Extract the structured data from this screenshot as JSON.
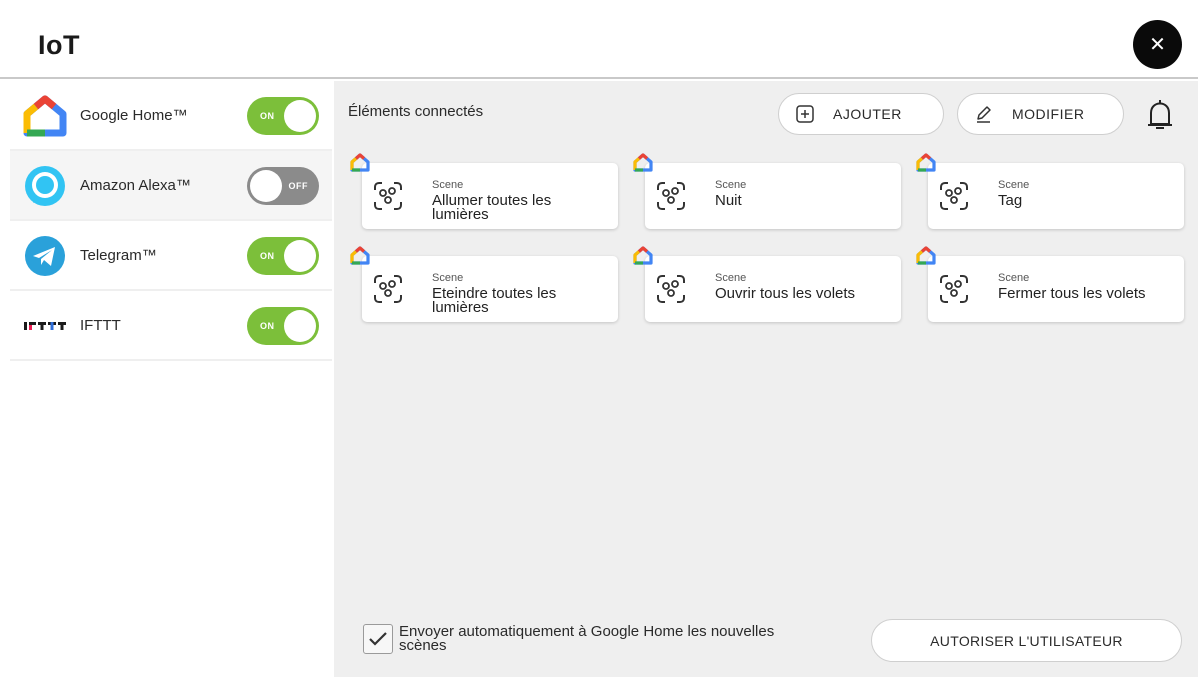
{
  "app": {
    "title": "IoT",
    "close_icon": "close-icon"
  },
  "sidebar": {
    "items": [
      {
        "label": "Google Home™",
        "icon": "google-home-icon",
        "toggle": "ON",
        "state": "on"
      },
      {
        "label": "Amazon Alexa™",
        "icon": "alexa-icon",
        "toggle": "OFF",
        "state": "off"
      },
      {
        "label": "Telegram™",
        "icon": "telegram-icon",
        "toggle": "ON",
        "state": "on"
      },
      {
        "label": "IFTTT",
        "icon": "ifttt-logo",
        "toggle": "ON",
        "state": "on"
      }
    ]
  },
  "main": {
    "section_title": "Éléments connectés",
    "add_label": "AJOUTER",
    "edit_label": "MODIFIER",
    "cards": [
      {
        "type": "Scene",
        "name": "Allumer toutes les lumières"
      },
      {
        "type": "Scene",
        "name": "Nuit"
      },
      {
        "type": "Scene",
        "name": "Tag"
      },
      {
        "type": "Scene",
        "name": "Eteindre toutes les lumières"
      },
      {
        "type": "Scene",
        "name": "Ouvrir tous les volets"
      },
      {
        "type": "Scene",
        "name": "Fermer tous les volets"
      }
    ],
    "auto_send_label": "Envoyer automatiquement à Google Home les nouvelles scènes",
    "auto_send_checked": true,
    "authorize_label": "AUTORISER L'UTILISATEUR"
  },
  "colors": {
    "toggle_on": "#7cbf3a",
    "toggle_off": "#8b8b8b",
    "google_red": "#ea4335",
    "google_yellow": "#fbbc04",
    "google_green": "#34a853",
    "google_blue": "#4285f4",
    "alexa_blue": "#31c4f3",
    "telegram_blue": "#2aa1da"
  }
}
